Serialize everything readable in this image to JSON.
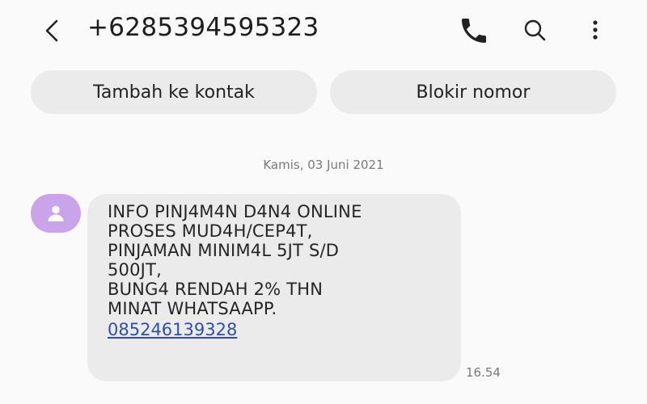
{
  "header": {
    "title": "+6285394595323",
    "icons": [
      "back-arrow-icon",
      "phone-icon",
      "search-icon",
      "more-vert-icon"
    ]
  },
  "actions": {
    "add_contact": "Tambah ke kontak",
    "block_number": "Blokir nomor"
  },
  "conversation": {
    "date": "Kamis, 03 Juni 2021",
    "message": {
      "lines": [
        "INFO PINJ4M4N D4N4 ONLINE",
        "PROSES MUD4H/CEP4T,",
        "PINJAMAN MINIM4L 5JT S/D",
        "500JT,",
        "BUNG4 RENDAH 2% THN",
        "MINAT WHATSAAPP."
      ],
      "link": "085246139328",
      "time": "16.54"
    }
  },
  "colors": {
    "background": "#fafafa",
    "pill": "#ebebeb",
    "bubble": "#ebebeb",
    "avatar": "#c9a4ea",
    "link": "#2f4fb0"
  }
}
